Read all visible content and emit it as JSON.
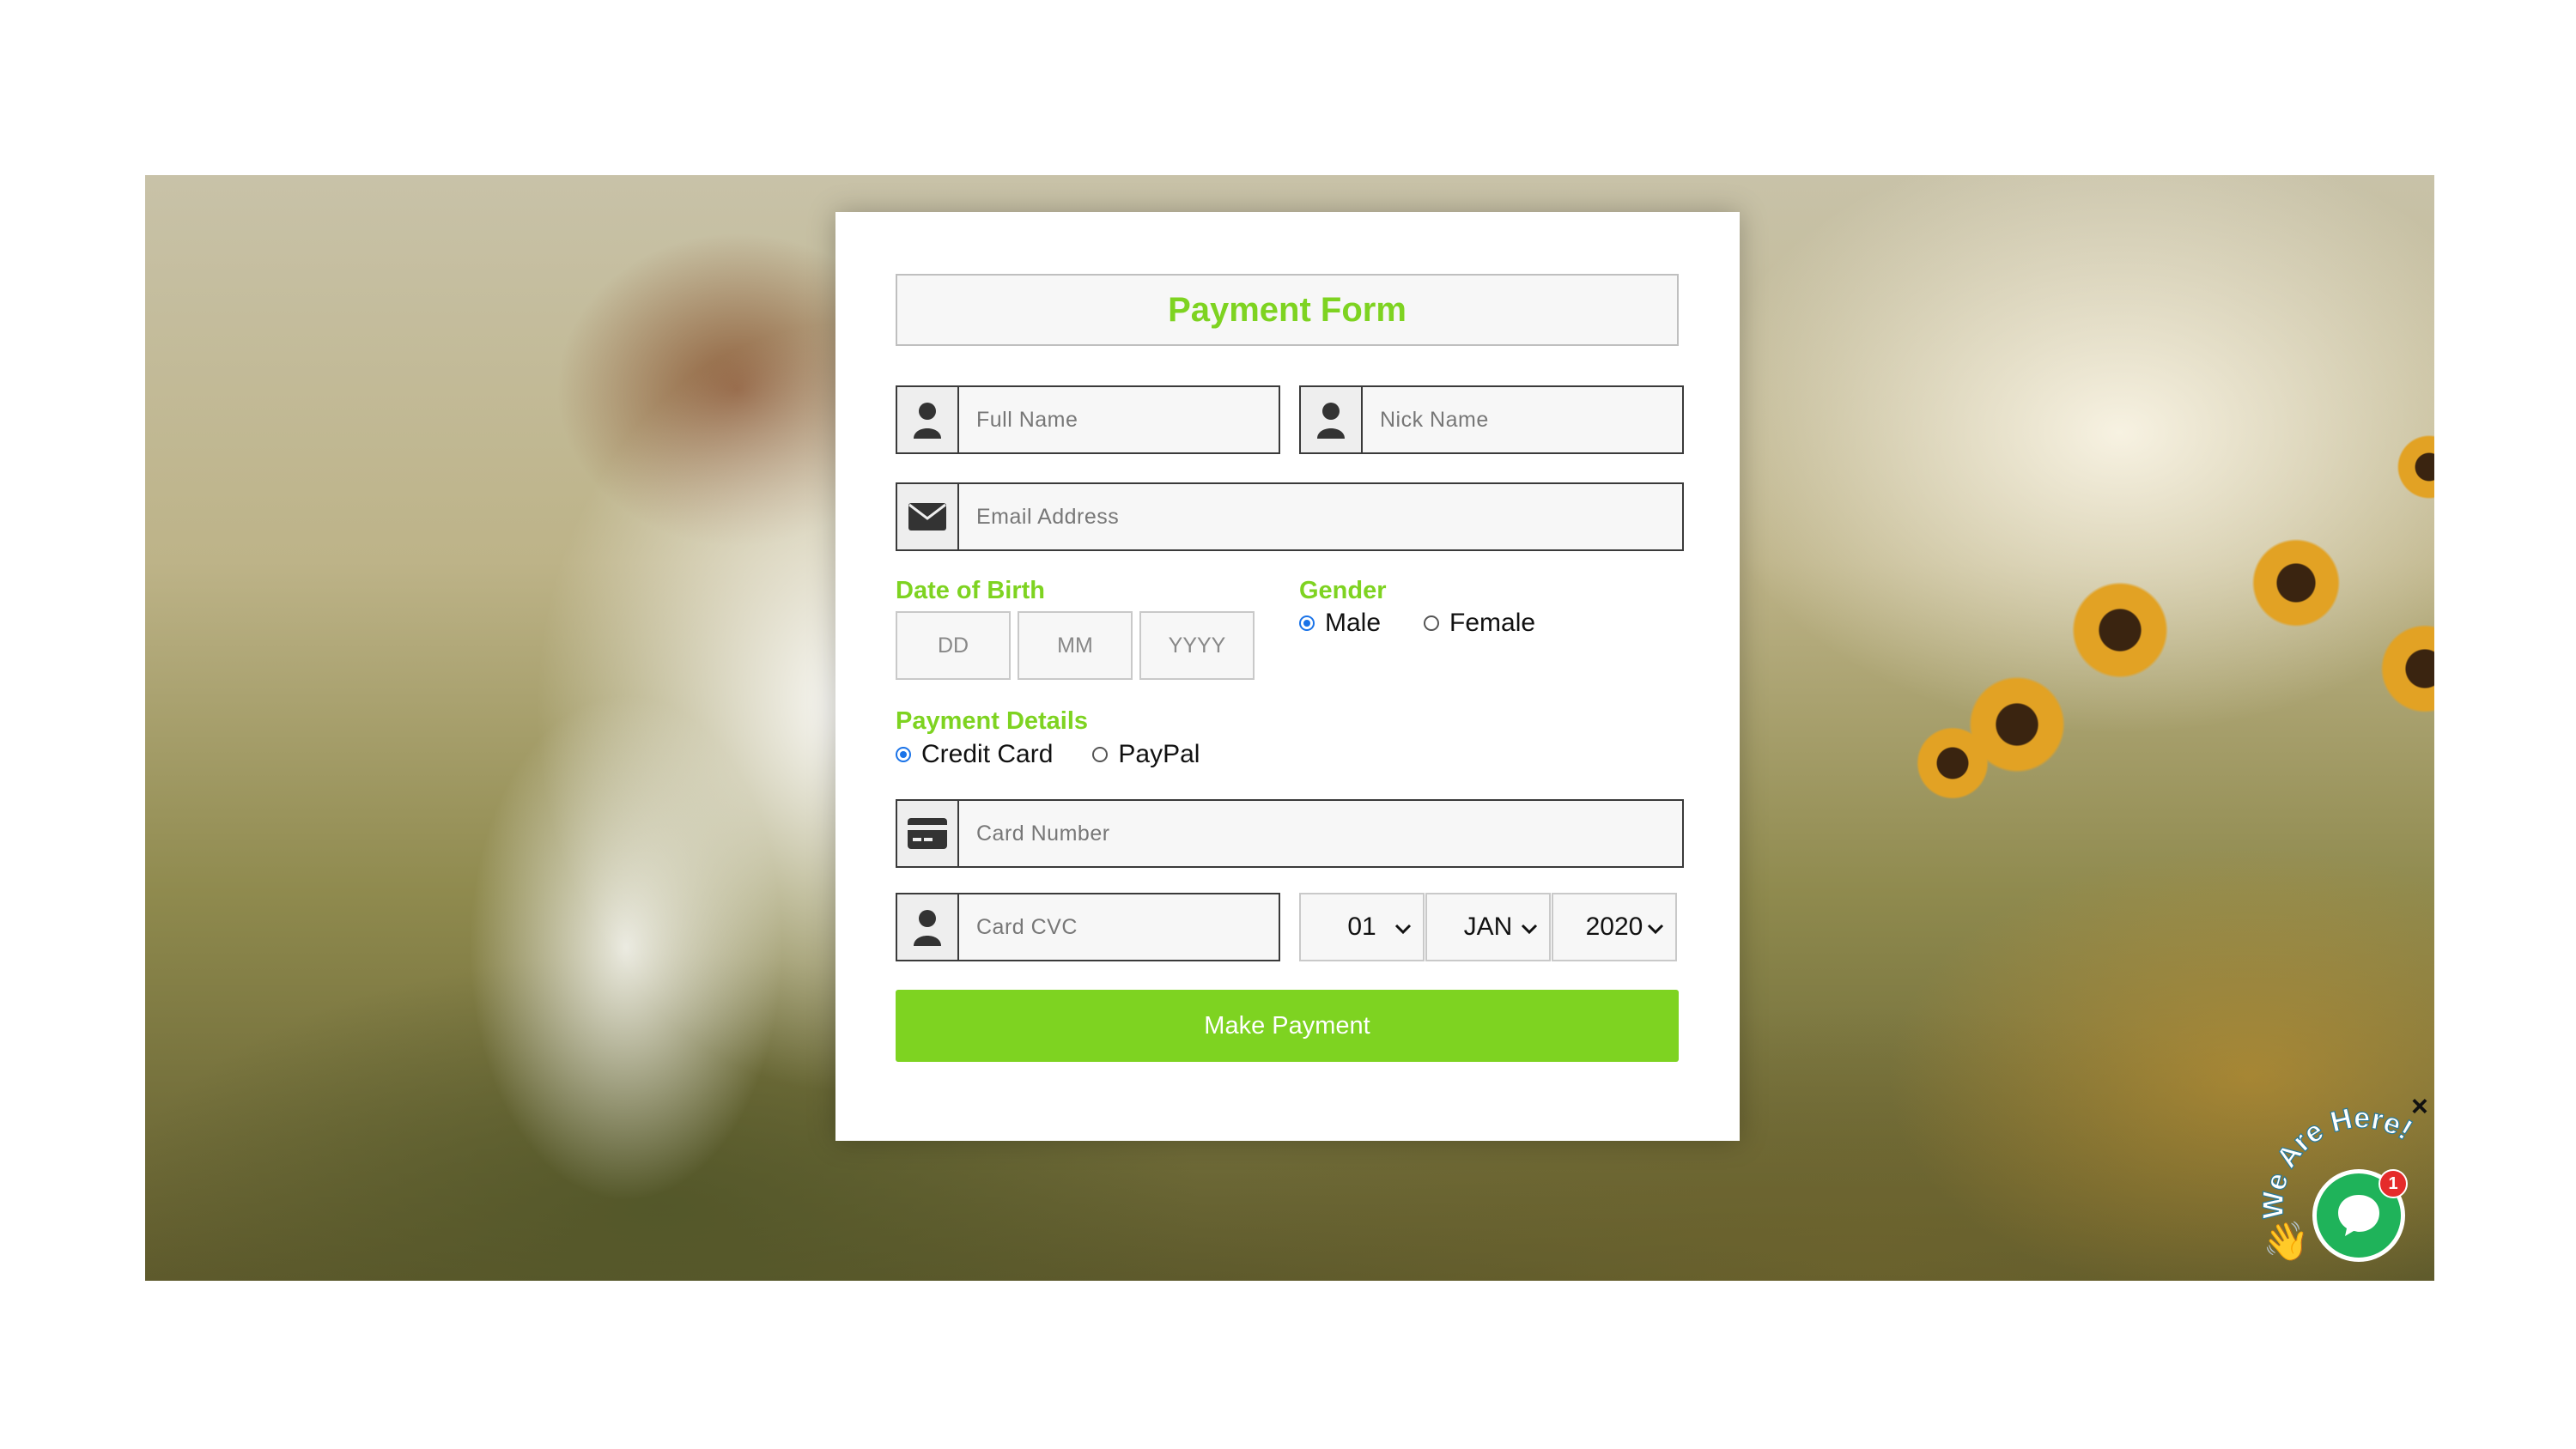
{
  "form": {
    "title": "Payment Form",
    "full_name_placeholder": "Full Name",
    "nick_name_placeholder": "Nick Name",
    "email_placeholder": "Email Address",
    "dob_label": "Date of Birth",
    "dob_day_placeholder": "DD",
    "dob_month_placeholder": "MM",
    "dob_year_placeholder": "YYYY",
    "gender_label": "Gender",
    "gender_options": [
      {
        "label": "Male",
        "selected": true
      },
      {
        "label": "Female",
        "selected": false
      }
    ],
    "payment_label": "Payment Details",
    "payment_options": [
      {
        "label": "Credit Card",
        "selected": true
      },
      {
        "label": "PayPal",
        "selected": false
      }
    ],
    "card_number_placeholder": "Card Number",
    "card_cvc_placeholder": "Card CVC",
    "expiry_day": "01",
    "expiry_month": "JAN",
    "expiry_year": "2020",
    "submit_label": "Make Payment"
  },
  "chat_widget": {
    "tagline": "We Are Here!",
    "badge_count": "1",
    "close_symbol": "×"
  },
  "icons": {
    "name": "user-icon",
    "email": "envelope-icon",
    "card": "credit-card-icon",
    "cvc": "user-icon",
    "chat": "chat-bubble-icon",
    "wave": "waving-hand-icon",
    "close": "close-icon"
  },
  "colors": {
    "accent": "#7ed321",
    "chat_green": "#1fb35a",
    "badge_red": "#e52b2b",
    "radio_blue": "#1a73e8"
  }
}
